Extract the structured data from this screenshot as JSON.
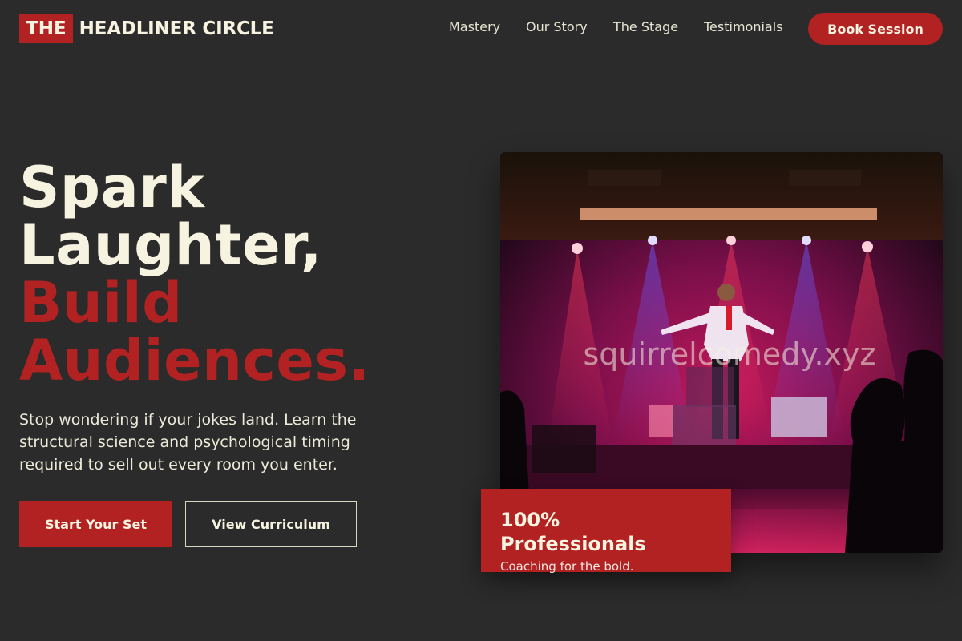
{
  "header": {
    "logo_box": "THE",
    "logo_text": "HEADLINER CIRCLE",
    "nav": [
      "Mastery",
      "Our Story",
      "The Stage",
      "Testimonials"
    ],
    "cta": "Book Session"
  },
  "hero": {
    "title_lines": [
      "Spark",
      "Laughter,",
      "Build",
      "Audiences."
    ],
    "subtitle": "Stop wondering if your jokes land. Learn the structural science and psychological timing required to sell out every room you enter.",
    "primary_button": "Start Your Set",
    "secondary_button": "View Curriculum"
  },
  "photo": {
    "watermark": "squirrelcomedy.xyz",
    "description_icon": "stage-photo"
  },
  "badge": {
    "title": "100% Professionals",
    "subtitle": "Coaching for the bold."
  },
  "colors": {
    "background": "#2b2b2b",
    "accent": "#b22222",
    "text": "#f6f3e0"
  }
}
